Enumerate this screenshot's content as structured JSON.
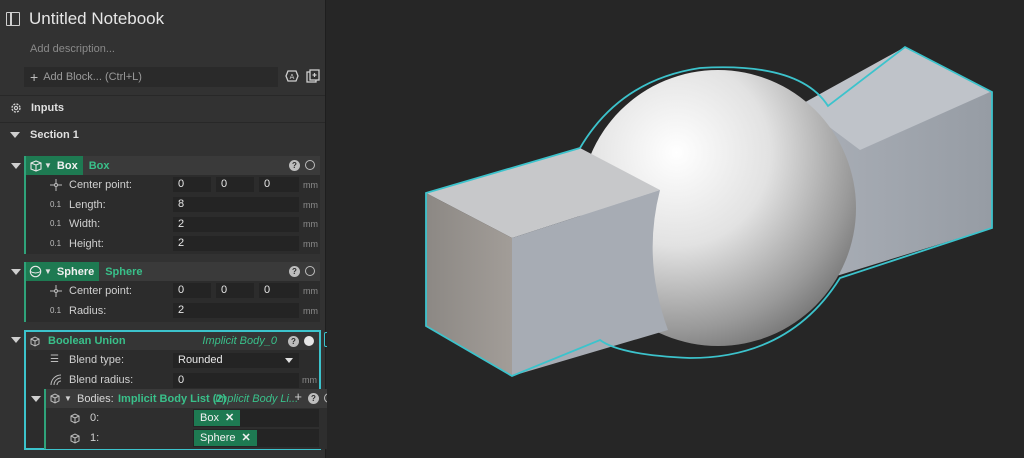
{
  "notebook": {
    "title": "Untitled Notebook",
    "description_placeholder": "Add description...",
    "add_block_placeholder": "Add Block... (Ctrl+L)"
  },
  "inputs_label": "Inputs",
  "section": {
    "label": "Section 1"
  },
  "box_block": {
    "chip_label": "Box",
    "name": "Box",
    "rows": [
      {
        "label": "Center point:",
        "values": [
          "0",
          "0",
          "0"
        ],
        "unit": "mm"
      },
      {
        "label": "Length:",
        "value": "8",
        "unit": "mm"
      },
      {
        "label": "Width:",
        "value": "2",
        "unit": "mm"
      },
      {
        "label": "Height:",
        "value": "2",
        "unit": "mm"
      }
    ]
  },
  "sphere_block": {
    "chip_label": "Sphere",
    "name": "Sphere",
    "rows": [
      {
        "label": "Center point:",
        "values": [
          "0",
          "0",
          "0"
        ],
        "unit": "mm"
      },
      {
        "label": "Radius:",
        "value": "2",
        "unit": "mm"
      }
    ]
  },
  "union_block": {
    "name": "Boolean Union",
    "output": "Implicit Body_0",
    "blend_type_label": "Blend type:",
    "blend_type_value": "Rounded",
    "blend_radius_label": "Blend radius:",
    "blend_radius_value": "0",
    "blend_radius_unit": "mm",
    "bodies": {
      "label": "Bodies:",
      "type": "Implicit Body List (2)",
      "output": "Implicit Body Li...",
      "items": [
        {
          "index": "0:",
          "tag": "Box"
        },
        {
          "index": "1:",
          "tag": "Sphere"
        }
      ]
    }
  },
  "icon_names": [
    "notebook-icon",
    "plus-icon",
    "ai-assist-icon",
    "paste-block-icon",
    "inputs-gear-icon",
    "box-cube-icon",
    "sphere-icon",
    "point-icon",
    "dimension-icon",
    "union-icon",
    "list-icon",
    "radius-icon",
    "help-icon"
  ],
  "colors": {
    "accent_green": "#1e7a52",
    "name_green": "#39c08a",
    "selection_cyan": "#3cc3cc"
  }
}
